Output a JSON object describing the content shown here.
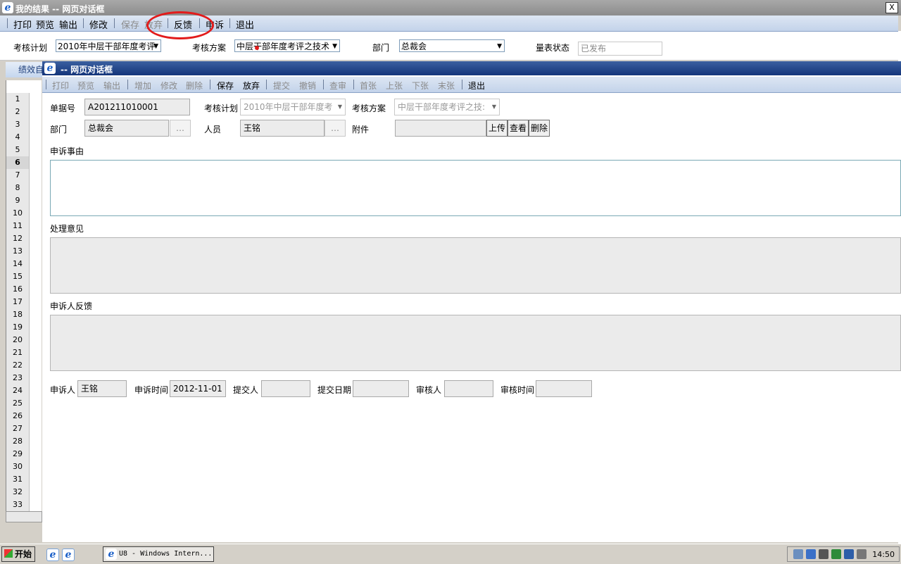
{
  "outer_window": {
    "title": "我的结果  --  网页对话框",
    "close_label": "X",
    "toolbar": [
      {
        "label": "打印",
        "enabled": true
      },
      {
        "label": "预览",
        "enabled": true
      },
      {
        "label": "输出",
        "enabled": true
      },
      {
        "label": "修改",
        "enabled": true
      },
      {
        "label": "保存",
        "enabled": false
      },
      {
        "label": "放弃",
        "enabled": false
      },
      {
        "label": "反馈",
        "enabled": true
      },
      {
        "label": "申诉",
        "enabled": true
      },
      {
        "label": "退出",
        "enabled": true
      }
    ],
    "filters": {
      "plan_label": "考核计划",
      "plan_value": "2010年中层干部年度考评",
      "scheme_label": "考核方案",
      "scheme_value": "中层干部年度考评之技术",
      "dept_label": "部门",
      "dept_value": "总裁会",
      "status_label": "量表状态",
      "status_value": "已发布"
    },
    "side_tab": "绩效自",
    "row_numbers": [
      "1",
      "2",
      "3",
      "4",
      "5",
      "6",
      "7",
      "8",
      "9",
      "10",
      "11",
      "12",
      "13",
      "14",
      "15",
      "16",
      "17",
      "18",
      "19",
      "20",
      "21",
      "22",
      "23",
      "24",
      "25",
      "26",
      "27",
      "28",
      "29",
      "30",
      "31",
      "32",
      "33"
    ],
    "selected_row": "6"
  },
  "dialog": {
    "title": "--  网页对话框",
    "toolbar": [
      {
        "label": "打印",
        "enabled": false
      },
      {
        "label": "预览",
        "enabled": false
      },
      {
        "label": "输出",
        "enabled": false
      },
      {
        "label": "增加",
        "enabled": false
      },
      {
        "label": "修改",
        "enabled": false
      },
      {
        "label": "删除",
        "enabled": false
      },
      {
        "label": "保存",
        "enabled": true
      },
      {
        "label": "放弃",
        "enabled": true
      },
      {
        "label": "提交",
        "enabled": false
      },
      {
        "label": "撤销",
        "enabled": false
      },
      {
        "label": "查审",
        "enabled": false
      },
      {
        "label": "首张",
        "enabled": false
      },
      {
        "label": "上张",
        "enabled": false
      },
      {
        "label": "下张",
        "enabled": false
      },
      {
        "label": "末张",
        "enabled": false
      },
      {
        "label": "退出",
        "enabled": true
      }
    ],
    "form": {
      "doc_no_label": "单据号",
      "doc_no_value": "A201211010001",
      "plan_label": "考核计划",
      "plan_value": "2010年中层干部年度考",
      "scheme_label": "考核方案",
      "scheme_value": "中层干部年度考评之技:",
      "dept_label": "部门",
      "dept_value": "总裁会",
      "person_label": "人员",
      "person_value": "王铭",
      "attach_label": "附件",
      "attach_value": "",
      "ellipsis": "…",
      "upload_label": "上传",
      "view_label": "查看",
      "delete_label": "删除",
      "reason_label": "申诉事由",
      "opinion_label": "处理意见",
      "feedback_label": "申诉人反馈",
      "appellant_label": "申诉人",
      "appellant_value": "王铭",
      "appeal_time_label": "申诉时间",
      "appeal_time_value": "2012-11-01",
      "submitter_label": "提交人",
      "submitter_value": "",
      "submit_date_label": "提交日期",
      "submit_date_value": "",
      "reviewer_label": "审核人",
      "reviewer_value": "",
      "review_time_label": "审核时间",
      "review_time_value": ""
    }
  },
  "taskbar": {
    "start_label": "开始",
    "task_label": "U8 - Windows Intern...",
    "clock": "14:50"
  },
  "colors": {
    "annotation": "#e21b1b",
    "dialog_title": "#14357a",
    "toolbar_bg": "#c3d3ea"
  }
}
